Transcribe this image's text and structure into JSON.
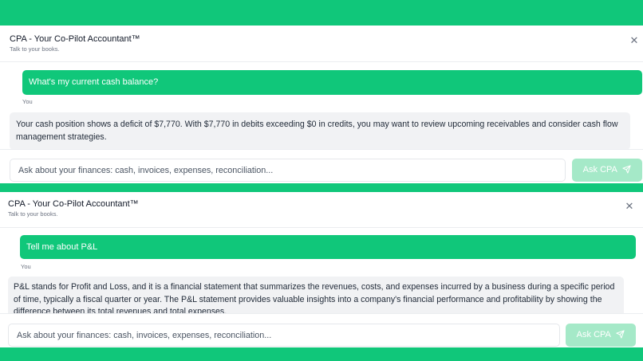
{
  "panels": [
    {
      "title": "CPA - Your Co-Pilot Accountant™",
      "subtitle": "Talk to your books.",
      "user_message": "What's my current cash balance?",
      "user_label": "You",
      "assistant_message": "Your cash position shows a deficit of $7,770. With $7,770 in debits exceeding $0 in credits, you may want to review upcoming receivables and consider cash flow management strategies.",
      "input_placeholder": "Ask about your finances: cash, invoices, expenses, reconciliation...",
      "ask_label": "Ask CPA"
    },
    {
      "title": "CPA - Your Co-Pilot Accountant™",
      "subtitle": "Talk to your books.",
      "user_message": "Tell me about P&L",
      "user_label": "You",
      "assistant_message": "P&L stands for Profit and Loss, and it is a financial statement that summarizes the revenues, costs, and expenses incurred by a business during a specific period of time, typically a fiscal quarter or year. The P&L statement provides valuable insights into a company's financial performance and profitability by showing the difference between its total revenues and total expenses.",
      "input_placeholder": "Ask about your finances: cash, invoices, expenses, reconciliation...",
      "ask_label": "Ask CPA"
    }
  ],
  "colors": {
    "brand_green": "#10c77a",
    "button_disabled": "#a5e9c8",
    "assistant_bubble": "#f1f2f4"
  },
  "icons": {
    "close": "close-icon",
    "send": "send-icon"
  }
}
